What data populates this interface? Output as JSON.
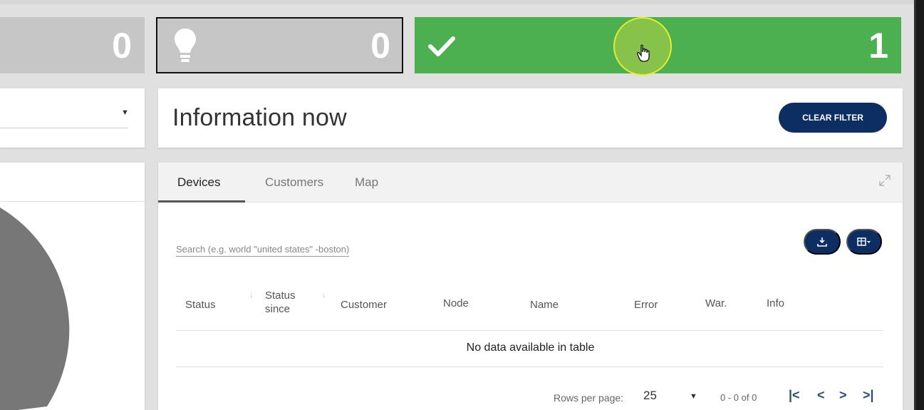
{
  "stats": [
    {
      "value": "0",
      "color": "#c6c6c6"
    },
    {
      "value": "0",
      "icon": "lightbulb-icon",
      "color": "#c6c6c6"
    },
    {
      "value": "1",
      "icon": "checkmark-icon",
      "color": "#4caf50"
    }
  ],
  "info": {
    "title": "Information now",
    "clear_filter": "CLEAR FILTER"
  },
  "tabs": [
    {
      "label": "Devices",
      "active": true
    },
    {
      "label": "Customers",
      "active": false
    },
    {
      "label": "Map",
      "active": false
    }
  ],
  "search": {
    "placeholder": "Search (e.g. world \"united states\" -boston)"
  },
  "table": {
    "columns": [
      "Status",
      "Status since",
      "Customer",
      "Node",
      "Name",
      "Error",
      "War.",
      "Info"
    ],
    "empty_message": "No data available in table"
  },
  "pagination": {
    "rows_per_page_label": "Rows per page:",
    "rows_per_page": "25",
    "range": "0 - 0 of 0"
  },
  "colors": {
    "accent": "#0d2e63",
    "success": "#4caf50",
    "muted": "#c6c6c6"
  }
}
